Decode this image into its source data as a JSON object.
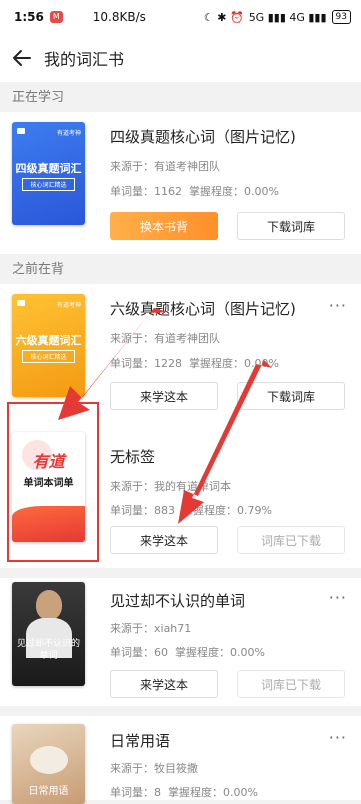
{
  "statusbar": {
    "time": "1:56",
    "badge": "M",
    "network": "10.8KB/s",
    "icons": "☾ ✱ ⏰",
    "signal": "5G ▮▮▮ 4G ▮▮▮",
    "battery": "93"
  },
  "header": {
    "title": "我的词汇书"
  },
  "sections": {
    "current": "正在学习",
    "previous": "之前在背"
  },
  "books": [
    {
      "title": "四级真题核心词（图片记忆)",
      "source_label": "来源于：",
      "source": "有道考神团队",
      "count_label": "单词量：",
      "count": "1162",
      "mastery_label": "掌握程度：",
      "mastery": "0.00%",
      "btn1": "换本书背",
      "btn2": "下载词库",
      "cover_title": "四级真题词汇",
      "cover_sub": "核心词汇精选",
      "cover_tag": "有道考神"
    },
    {
      "title": "六级真题核心词（图片记忆)",
      "source_label": "来源于：",
      "source": "有道考神团队",
      "count_label": "单词量：",
      "count": "1228",
      "mastery_label": "掌握程度：",
      "mastery": "0.00%",
      "btn1": "来学这本",
      "btn2": "下载词库",
      "cover_title": "六级真题词汇",
      "cover_sub": "核心词汇精选",
      "cover_tag": "有道考神"
    },
    {
      "title": "无标签",
      "source_label": "来源于：",
      "source": "我的有道单词本",
      "count_label": "单词量：",
      "count": "883",
      "mastery_label": "掌握程度：",
      "mastery": "0.79%",
      "btn1": "来学这本",
      "btn2": "词库已下载",
      "cover_logo": "有道",
      "cover_title": "单词本词单"
    },
    {
      "title": "见过却不认识的单词",
      "source_label": "来源于：",
      "source": "xiah71",
      "count_label": "单词量：",
      "count": "60",
      "mastery_label": "掌握程度：",
      "mastery": "0.00%",
      "btn1": "来学这本",
      "btn2": "词库已下载",
      "cover_title": "见过却不认识的单词"
    },
    {
      "title": "日常用语",
      "source_label": "来源于：",
      "source": "牧目筱撒",
      "count_label": "单词量：",
      "count": "8",
      "mastery_label": "掌握程度：",
      "mastery": "0.00%",
      "cover_title": "日常用语"
    }
  ],
  "more_label": "···"
}
